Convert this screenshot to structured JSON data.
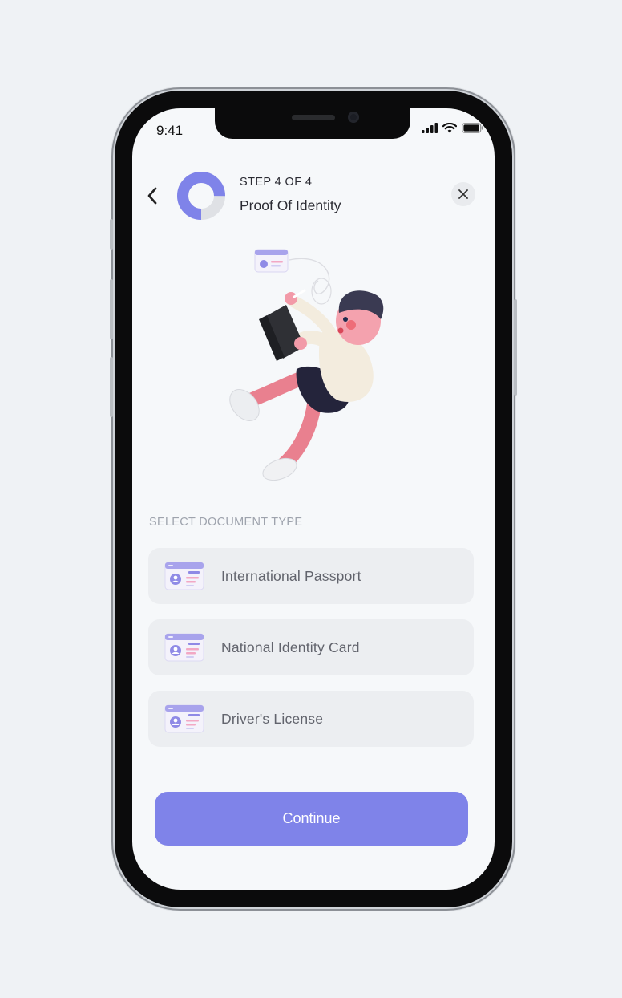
{
  "status_bar": {
    "time": "9:41"
  },
  "header": {
    "step_label": "STEP 4 OF 4",
    "title": "Proof Of Identity",
    "progress_fraction": 0.75
  },
  "section_label": "SELECT DOCUMENT TYPE",
  "document_options": [
    {
      "label": "International Passport",
      "icon": "id-card-icon"
    },
    {
      "label": "National Identity Card",
      "icon": "id-card-icon"
    },
    {
      "label": "Driver's License",
      "icon": "id-card-icon"
    }
  ],
  "continue_label": "Continue",
  "colors": {
    "accent": "#7f83e9",
    "progress_track": "#dfe1e5",
    "option_background": "#eceef1"
  }
}
